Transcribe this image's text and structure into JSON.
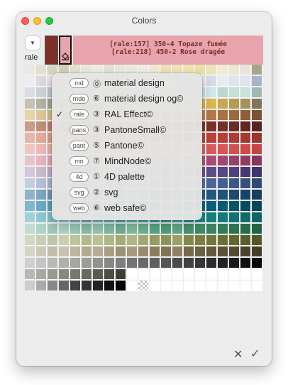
{
  "window": {
    "title": "Colors"
  },
  "palette_button_label": "rale",
  "selected_color": {
    "primary_hex": "#7d3026",
    "secondary_hex": "#e8a4ac",
    "info_line1": "[rale:157] 350-4 Topaze fumée",
    "info_line2": "[rale:218] 450-2 Rose dragée"
  },
  "palette_menu": [
    {
      "tag": "md",
      "number": "⓪",
      "label": "material design",
      "checked": false
    },
    {
      "tag": "mdo",
      "number": "⑥",
      "label": "material design og©",
      "checked": false
    },
    {
      "tag": "rale",
      "number": "③",
      "label": "RAL Effect©",
      "checked": true
    },
    {
      "tag": "pans",
      "number": "③",
      "label": "PantoneSmall©",
      "checked": false
    },
    {
      "tag": "pant",
      "number": "⑤",
      "label": "Pantone©",
      "checked": false
    },
    {
      "tag": "mn",
      "number": "⑦",
      "label": "MindNode©",
      "checked": false
    },
    {
      "tag": "4d",
      "number": "①",
      "label": "4D palette",
      "checked": false
    },
    {
      "tag": "svg",
      "number": "②",
      "label": "svg",
      "checked": false
    },
    {
      "tag": "web",
      "number": "⑥",
      "label": "web safe©",
      "checked": false
    }
  ],
  "swatch_rows": [
    [
      "#eaeae3",
      "#e2e0d2",
      "#d9d6c4",
      "#d4d1bd",
      "#e7e4cf",
      "#ecebd8",
      "#eff0e4",
      "#e3e6d8",
      "#eaeae0",
      "#ebebe4",
      "#f1efe2",
      "#f1ecd0",
      "#ede3b3",
      "#efe6b9",
      "#f0e6b0",
      "#ece2a7",
      "#ebe3b8",
      "#f0ebd3",
      "#ebe7d3",
      "#e5e5dc",
      "#a7a68a"
    ],
    [
      "#ededf1",
      "#dadadf",
      "#e4e1e7",
      "#e4dde3",
      "#ebdbe1",
      "#e3d3d9",
      "#f2e3e5",
      "#f3dbe0",
      "#edd3d8",
      "#f1e5e7",
      "#e6dbdf",
      "#e3e3eb",
      "#e6e6ee",
      "#dbdde5",
      "#d6dbe5",
      "#e0e4ec",
      "#d7dde8",
      "#e6ecf2",
      "#dde6ee",
      "#e0e4ee",
      "#a8b4c8"
    ],
    [
      "#d8dde1",
      "#c9d4da",
      "#bcc8cc",
      "#d5dde0",
      "#cdd9de",
      "#c2d1d7",
      "#d1e1e6",
      "#c7d9df",
      "#bdd3da",
      "#c6dfe6",
      "#b8d8e0",
      "#c0e0e6",
      "#b5dbe3",
      "#c9e6ea",
      "#b3dde5",
      "#bfe3e8",
      "#cfe9ec",
      "#bbd7d4",
      "#c2dfd9",
      "#c7e2d8",
      "#9fb7b5"
    ],
    [
      "#c3c1b5",
      "#b4b2a3",
      "#a5a393",
      "#a8b28e",
      "#9cb080",
      "#8fa56f",
      "#a2b680",
      "#b0c78f",
      "#9bb67a",
      "#c0cc80",
      "#b3c06a",
      "#c7cc6d",
      "#d6c85e",
      "#dec152",
      "#e2b842",
      "#ddb345",
      "#e1b84b",
      "#caa755",
      "#b59b55",
      "#a8925c",
      "#83745c"
    ],
    [
      "#e6d4a8",
      "#ddc898",
      "#d3bd8a",
      "#e5c078",
      "#e3b65f",
      "#dcaa4e",
      "#e0a456",
      "#dda05a",
      "#d5944f",
      "#d38a4a",
      "#cf8148",
      "#c97644",
      "#c56f42",
      "#cb7a4b",
      "#d18b5a",
      "#c48653",
      "#b87a47",
      "#a86f42",
      "#9d6840",
      "#8f5e3b",
      "#7b5235"
    ],
    [
      "#c79d8a",
      "#c2907b",
      "#b98370",
      "#c58b76",
      "#c27c68",
      "#bb6f5c",
      "#c47766",
      "#b96657",
      "#ad5b4c",
      "#b4584a",
      "#a94d41",
      "#a04539",
      "#99413a",
      "#a0483f",
      "#8e3c35",
      "#843631",
      "#7a322c",
      "#763029",
      "#6c2b26",
      "#622723",
      "#56241f"
    ],
    [
      "#e8b6a6",
      "#e7a898",
      "#e29988",
      "#e7a08a",
      "#e48c77",
      "#e07f69",
      "#e58b78",
      "#e07a66",
      "#dc6d5a",
      "#e07868",
      "#dc6353",
      "#d85445",
      "#d54d42",
      "#d85a4f",
      "#cf4a41",
      "#c8443c",
      "#c24037",
      "#bb3e36",
      "#b23a33",
      "#a8372f",
      "#9d342d"
    ],
    [
      "#f0c5c0",
      "#efbab5",
      "#ecaea9",
      "#f0b9b2",
      "#eea59f",
      "#eb9a94",
      "#efa9a3",
      "#ec9b94",
      "#e88d87",
      "#ef9e9b",
      "#ea8e8b",
      "#e6807d",
      "#e57a78",
      "#e88a88",
      "#e47270",
      "#e06663",
      "#dc5c5a",
      "#d85553",
      "#d45050",
      "#ce4a4a",
      "#c44545"
    ],
    [
      "#e9c2cb",
      "#e7b6c0",
      "#e0a7b4",
      "#e8b3c0",
      "#e2a0b1",
      "#dd92a5",
      "#e39fb2",
      "#dd8ea4",
      "#d67f97",
      "#dd93a9",
      "#d6839d",
      "#cf7492",
      "#cc6b8b",
      "#d27d97",
      "#c46485",
      "#b9587b",
      "#ad4e72",
      "#a4476c",
      "#994164",
      "#8f3c5e",
      "#843759"
    ],
    [
      "#d3c8d8",
      "#c9bcd0",
      "#bdaec6",
      "#c4b5d0",
      "#b8a6c8",
      "#ac98bf",
      "#b3a1c7",
      "#a38fbd",
      "#9580b3",
      "#a695c0",
      "#9783b7",
      "#8872ad",
      "#7e67a6",
      "#8d79b0",
      "#7661a1",
      "#6b5797",
      "#604d8d",
      "#574785",
      "#4e407c",
      "#473a74",
      "#3f346b"
    ],
    [
      "#c3cde2",
      "#b5c1dc",
      "#a7b5d5",
      "#b2bfdc",
      "#a2b2d4",
      "#94a5cd",
      "#9fb1d4",
      "#8fa3cc",
      "#8095c3",
      "#8ea5cc",
      "#7d96c3",
      "#6d87ba",
      "#637eb3",
      "#7591bf",
      "#5f7cb0",
      "#5572a6",
      "#4b689c",
      "#446092",
      "#3d5788",
      "#36507e",
      "#304974"
    ],
    [
      "#8fb3c8",
      "#7ea6bf",
      "#6e98b5",
      "#7aa3c1",
      "#6894b6",
      "#5888ad",
      "#6a98bb",
      "#5689b1",
      "#477ca7",
      "#5b93b9",
      "#4686b0",
      "#3a79a5",
      "#33709d",
      "#4483ad",
      "#2f6c97",
      "#2a638c",
      "#255a82",
      "#215279",
      "#1d4b70",
      "#194468",
      "#163e60"
    ],
    [
      "#7db6cf",
      "#6aaac7",
      "#589fbe",
      "#65abc7",
      "#4f9ebf",
      "#3e93b6",
      "#4d9dbf",
      "#3891b6",
      "#2786ad",
      "#3893b5",
      "#2789ad",
      "#1b7fa3",
      "#15789b",
      "#2688a9",
      "#116f90",
      "#0e6886",
      "#0b617c",
      "#095a73",
      "#07536a",
      "#064c62",
      "#05465a"
    ],
    [
      "#9fd2d8",
      "#8dc9d1",
      "#7abfc8",
      "#88cad1",
      "#72bfc7",
      "#5db4be",
      "#6cbec5",
      "#56b3bb",
      "#41a8b1",
      "#53b4b9",
      "#3ea9ae",
      "#2b9fa4",
      "#23979b",
      "#33a2a5",
      "#1f8f91",
      "#1b8789",
      "#178081",
      "#14797a",
      "#117273",
      "#0f6b6c",
      "#0d6465"
    ],
    [
      "#bfdcd2",
      "#b0d3c7",
      "#a1cabc",
      "#aed3c3",
      "#9bc8b5",
      "#89bea8",
      "#98c6b1",
      "#84bba3",
      "#70b095",
      "#82bca0",
      "#6db190",
      "#5aa681",
      "#519f78",
      "#61aa86",
      "#46956e",
      "#3f8c66",
      "#39835e",
      "#337b57",
      "#2e7350",
      "#296b49",
      "#246443"
    ],
    [
      "#d2d8c4",
      "#c8cfb5",
      "#bec6a7",
      "#c9cfae",
      "#bdc49c",
      "#b1ba8b",
      "#bcc296",
      "#afb785",
      "#a2ac74",
      "#b1b585",
      "#a3a873",
      "#959b62",
      "#8d9358",
      "#9ba067",
      "#838946",
      "#7a8040",
      "#72783a",
      "#6a7035",
      "#626830",
      "#5a602b",
      "#535927"
    ],
    [
      "#d6d2c5",
      "#ccc7b8",
      "#c2bcab",
      "#c9c2ae",
      "#bdb59e",
      "#b1a88f",
      "#b8ad93",
      "#aa9f83",
      "#9c9174",
      "#a89a7d",
      "#998a6c",
      "#8b7c5d",
      "#827354",
      "#8f8063",
      "#776849",
      "#6e6042",
      "#65583c",
      "#5d5036",
      "#554931",
      "#4d432c",
      "#463d28"
    ],
    [
      "#cfcfcf",
      "#c4c4c4",
      "#b9b9b9",
      "#afafaf",
      "#a5a5a5",
      "#9b9b9b",
      "#919191",
      "#878787",
      "#7d7d7d",
      "#737373",
      "#696969",
      "#5f5f5f",
      "#555555",
      "#4b4b4b",
      "#414141",
      "#373737",
      "#2d2d2d",
      "#232323",
      "#1a1a1a",
      "#111111",
      "#080808"
    ],
    [
      "#b8b8b0",
      "#a8a89f",
      "#98988e",
      "#88887e",
      "#78786e",
      "#68685f",
      "#5a5a52",
      "#4c4c45",
      "#3e3e38",
      "#ffffff",
      "#ffffff",
      "#ffffff",
      "#ffffff",
      "#ffffff",
      "#ffffff",
      "#ffffff",
      "#ffffff",
      "#ffffff",
      "#ffffff",
      "#ffffff",
      "#ffffff"
    ],
    [
      "#cccccc",
      "#aaaaaa",
      "#888888",
      "#666666",
      "#444444",
      "#333333",
      "#222222",
      "#111111",
      "#000000",
      "#ffffff",
      "checker",
      "#ffffff",
      "#ffffff",
      "#ffffff",
      "#ffffff",
      "#ffffff",
      "#ffffff",
      "#ffffff",
      "#ffffff",
      "#ffffff",
      "#ffffff"
    ]
  ]
}
